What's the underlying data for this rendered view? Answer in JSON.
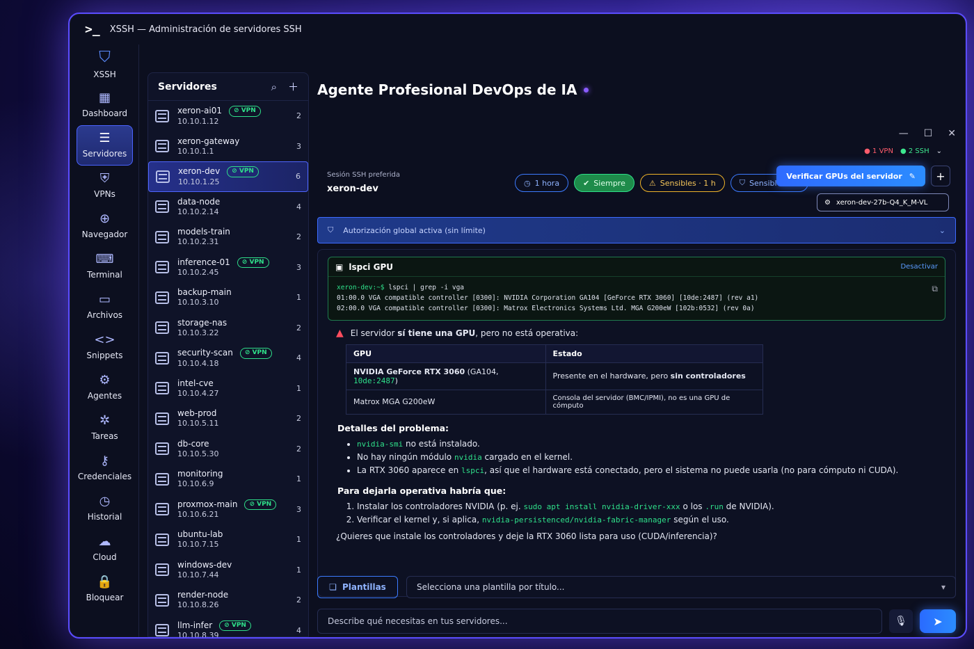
{
  "app": {
    "logo": ">_",
    "title": "XSSH — Administración de servidores SSH"
  },
  "window_controls": {
    "minimize": "—",
    "maximize": "☐",
    "close": "✕"
  },
  "nav": {
    "brand": {
      "icon": "shield-icon",
      "label": "XSSH"
    },
    "items": [
      {
        "icon": "grid-icon",
        "glyph": "▦",
        "label": "Dashboard",
        "active": false
      },
      {
        "icon": "servers-icon",
        "glyph": "☰",
        "label": "Servidores",
        "active": true
      },
      {
        "icon": "vpn-icon",
        "glyph": "⛨",
        "label": "VPNs",
        "active": false
      },
      {
        "icon": "globe-icon",
        "glyph": "⊕",
        "label": "Navegador",
        "active": false
      },
      {
        "icon": "terminal-icon",
        "glyph": "⌨",
        "label": "Terminal",
        "active": false
      },
      {
        "icon": "folder-icon",
        "glyph": "▭",
        "label": "Archivos",
        "active": false
      },
      {
        "icon": "code-icon",
        "glyph": "<>",
        "label": "Snippets",
        "active": false
      },
      {
        "icon": "robot-icon",
        "glyph": "⚙",
        "label": "Agentes",
        "active": false
      },
      {
        "icon": "tasks-icon",
        "glyph": "✲",
        "label": "Tareas",
        "active": false
      },
      {
        "icon": "key-icon",
        "glyph": "⚷",
        "label": "Credenciales",
        "active": false
      },
      {
        "icon": "history-icon",
        "glyph": "◷",
        "label": "Historial",
        "active": false
      },
      {
        "icon": "cloud-icon",
        "glyph": "☁",
        "label": "Cloud",
        "active": false
      },
      {
        "icon": "lock-icon",
        "glyph": "🔒",
        "label": "Bloquear",
        "active": false
      }
    ]
  },
  "servers": {
    "title": "Servidores",
    "list": [
      {
        "name": "xeron-ai01",
        "ip": "10.10.1.12",
        "vpn": true,
        "count": "2",
        "active": false
      },
      {
        "name": "xeron-gateway",
        "ip": "10.10.1.1",
        "vpn": false,
        "count": "3",
        "active": false
      },
      {
        "name": "xeron-dev",
        "ip": "10.10.1.25",
        "vpn": true,
        "count": "6",
        "active": true
      },
      {
        "name": "data-node",
        "ip": "10.10.2.14",
        "vpn": false,
        "count": "4",
        "active": false
      },
      {
        "name": "models-train",
        "ip": "10.10.2.31",
        "vpn": false,
        "count": "2",
        "active": false
      },
      {
        "name": "inference-01",
        "ip": "10.10.2.45",
        "vpn": true,
        "count": "3",
        "active": false
      },
      {
        "name": "backup-main",
        "ip": "10.10.3.10",
        "vpn": false,
        "count": "1",
        "active": false
      },
      {
        "name": "storage-nas",
        "ip": "10.10.3.22",
        "vpn": false,
        "count": "2",
        "active": false
      },
      {
        "name": "security-scan",
        "ip": "10.10.4.18",
        "vpn": true,
        "count": "4",
        "active": false
      },
      {
        "name": "intel-cve",
        "ip": "10.10.4.27",
        "vpn": false,
        "count": "1",
        "active": false
      },
      {
        "name": "web-prod",
        "ip": "10.10.5.11",
        "vpn": false,
        "count": "2",
        "active": false
      },
      {
        "name": "db-core",
        "ip": "10.10.5.30",
        "vpn": false,
        "count": "2",
        "active": false
      },
      {
        "name": "monitoring",
        "ip": "10.10.6.9",
        "vpn": false,
        "count": "1",
        "active": false
      },
      {
        "name": "proxmox-main",
        "ip": "10.10.6.21",
        "vpn": true,
        "count": "3",
        "active": false
      },
      {
        "name": "ubuntu-lab",
        "ip": "10.10.7.15",
        "vpn": false,
        "count": "1",
        "active": false
      },
      {
        "name": "windows-dev",
        "ip": "10.10.7.44",
        "vpn": false,
        "count": "1",
        "active": false
      },
      {
        "name": "render-node",
        "ip": "10.10.8.26",
        "vpn": false,
        "count": "2",
        "active": false
      },
      {
        "name": "llm-infer",
        "ip": "10.10.8.39",
        "vpn": true,
        "count": "4",
        "active": false
      }
    ],
    "vpn_label": "VPN"
  },
  "main": {
    "agent_title": "Agente Profesional DevOps de IA",
    "status": {
      "vpn": "1 VPN",
      "ssh": "2 SSH"
    },
    "session": {
      "label": "Sesión SSH preferida",
      "value": "xeron-dev"
    },
    "chips": [
      {
        "label": "1 hora",
        "style": "blue"
      },
      {
        "label": "Siempre",
        "style": "green"
      },
      {
        "label": "Sensibles · 1 h",
        "style": "yellow"
      },
      {
        "label": "Sensibles · ∞",
        "style": "blue2"
      }
    ],
    "verify_button": "Verificar GPUs del servidor",
    "model": "xeron-dev-27b-Q4_K_M-VL",
    "auth_bar": "Autorización global activa (sin límite)",
    "tool": {
      "title": "lspci GPU",
      "deactivate": "Desactivar",
      "prompt": "xeron-dev:~$",
      "command": " lspci | grep -i vga",
      "line1": "01:00.0 VGA compatible controller [0300]: NVIDIA Corporation GA104 [GeForce RTX 3060] [10de:2487] (rev a1)",
      "line2": "02:00.0 VGA compatible controller [0300]: Matrox Electronics Systems Ltd. MGA G200eW [102b:0532] (rev 0a)"
    },
    "answer": {
      "warn_pre": "El servidor ",
      "warn_bold": "sí tiene una GPU",
      "warn_post": ", pero no está operativa:",
      "table": {
        "h_gpu": "GPU",
        "h_state": "Estado",
        "row1_gpu_bold": "NVIDIA GeForce RTX 3060",
        "row1_gpu_rest": " (GA104, ",
        "row1_gpu_code": "10de:2487",
        "row1_gpu_end": ")",
        "row1_state_pre": "Presente en el hardware, pero ",
        "row1_state_bold": "sin controladores",
        "row2_gpu": "Matrox MGA G200eW",
        "row2_state": "Consola del servidor (BMC/IPMI), no es una GPU de cómputo"
      },
      "details_title": "Detalles del problema:",
      "details": {
        "d1_code": "nvidia-smi",
        "d1_text": " no está instalado.",
        "d2_pre": "No hay ningún módulo ",
        "d2_code": "nvidia",
        "d2_post": " cargado en el kernel.",
        "d3_pre": "La RTX 3060 aparece en ",
        "d3_code": "lspci",
        "d3_post": ", así que el hardware está conectado, pero el sistema no puede usarla (no para cómputo ni CUDA)."
      },
      "steps_title": "Para dejarla operativa habría que:",
      "steps": {
        "s1_pre": "Instalar los controladores NVIDIA (p. ej. ",
        "s1_code": "sudo apt install nvidia-driver-xxx",
        "s1_mid": " o los ",
        "s1_code2": ".run",
        "s1_post": " de NVIDIA).",
        "s2_pre": "Verificar el kernel y, si aplica, ",
        "s2_code": "nvidia-persistenced/nvidia-fabric-manager",
        "s2_post": " según el uso."
      },
      "question": "¿Quieres que instale los controladores y deje la RTX 3060 lista para uso (CUDA/inferencia)?"
    },
    "templates": {
      "button": "Plantillas",
      "select": "Selecciona una plantilla por título..."
    },
    "input": {
      "placeholder": "Describe qué necesitas en tus servidores..."
    }
  }
}
